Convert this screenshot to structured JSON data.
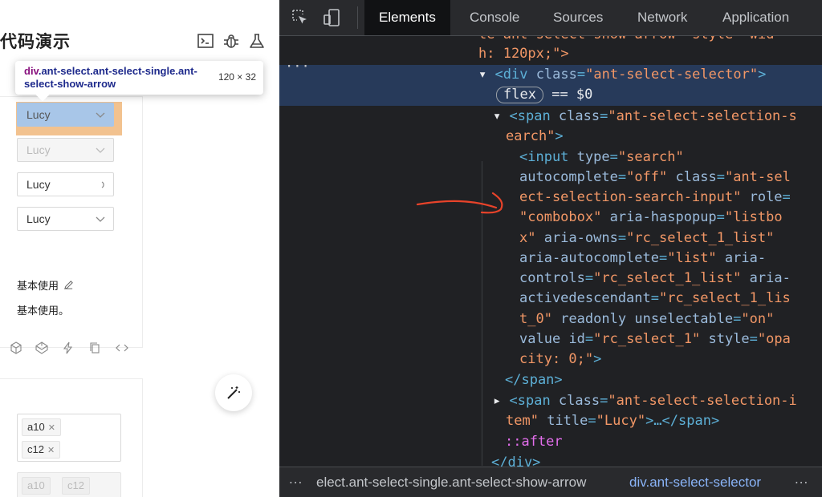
{
  "left": {
    "code_title": "代码演示",
    "tooltip": {
      "tag": "div",
      "classes": ".ant-select.ant-select-single.ant-select-show-arrow",
      "size": "120 × 32"
    },
    "selects": [
      {
        "value": "Lucy",
        "state": "highlighted"
      },
      {
        "value": "Lucy",
        "state": "disabled"
      },
      {
        "value": "Lucy",
        "state": "loading"
      },
      {
        "value": "Lucy",
        "state": "normal"
      }
    ],
    "section_title": "基本使用",
    "section_desc": "基本使用。",
    "multi_tags": [
      "a10",
      "c12"
    ],
    "multi_tags_disabled": [
      "a10",
      "c12"
    ]
  },
  "devtools": {
    "tabs": [
      "Elements",
      "Console",
      "Sources",
      "Network",
      "Application"
    ],
    "active_tab": "Elements",
    "dom_lines": {
      "l0": "te\"ant-select-show-arrow\" style=\"wid",
      "l1": "h: 120px;\">",
      "l2_tag_open": "<div ",
      "l2_attr": "class",
      "l2_val": "\"ant-select-selector\"",
      "l2_close": ">",
      "l3_badge": "flex",
      "l3_eq": "== $0",
      "l4_open": "<span ",
      "l4_attr": "class",
      "l4_val": "\"ant-select-selection-s",
      "l5_val": "earch\"",
      "l5_close": ">",
      "l6_open": "<input ",
      "l6_attr": "type",
      "l6_val": "\"search\"",
      "l7_attr1": "autocomplete",
      "l7_val1": "\"off\"",
      "l7_attr2": "class",
      "l7_val2": "\"ant-sel",
      "l8_val": "ect-selection-search-input\"",
      "l8_attr": "role",
      "l9_val": "\"combobox\"",
      "l9_attr": "aria-haspopup",
      "l9_val2": "\"listbo",
      "l10_val": "x\"",
      "l10_attr": "aria-owns",
      "l10_val2": "\"rc_select_1_list\"",
      "l11_attr": "aria-autocomplete",
      "l11_val": "\"list\"",
      "l11_attr2": "aria-",
      "l12_attr": "controls",
      "l12_val": "\"rc_select_1_list\"",
      "l12_attr2": "aria-",
      "l13_attr": "activedescendant",
      "l13_val": "\"rc_select_1_lis",
      "l14_val": "t_0\"",
      "l14_attr": "readonly",
      "l14_attr2": "unselectable",
      "l14_val2": "\"on\"",
      "l15_attr": "value",
      "l15_attr2": "id",
      "l15_val": "\"rc_select_1\"",
      "l15_attr3": "style",
      "l15_val3": "\"opa",
      "l16_val": "city: 0;\"",
      "l16_close": ">",
      "l17": "</span>",
      "l18_open": "<span ",
      "l18_attr": "class",
      "l18_val": "\"ant-select-selection-i",
      "l19_val": "tem\"",
      "l19_attr": "title",
      "l19_val2": "\"Lucy\"",
      "l19_close": ">…</span>",
      "l20": "::after",
      "l21": "</div>"
    },
    "dom_dots": "···",
    "breadcrumbs": [
      "elect.ant-select-single.ant-select-show-arrow",
      "div.ant-select-selector"
    ],
    "crumbs_more": "..."
  }
}
